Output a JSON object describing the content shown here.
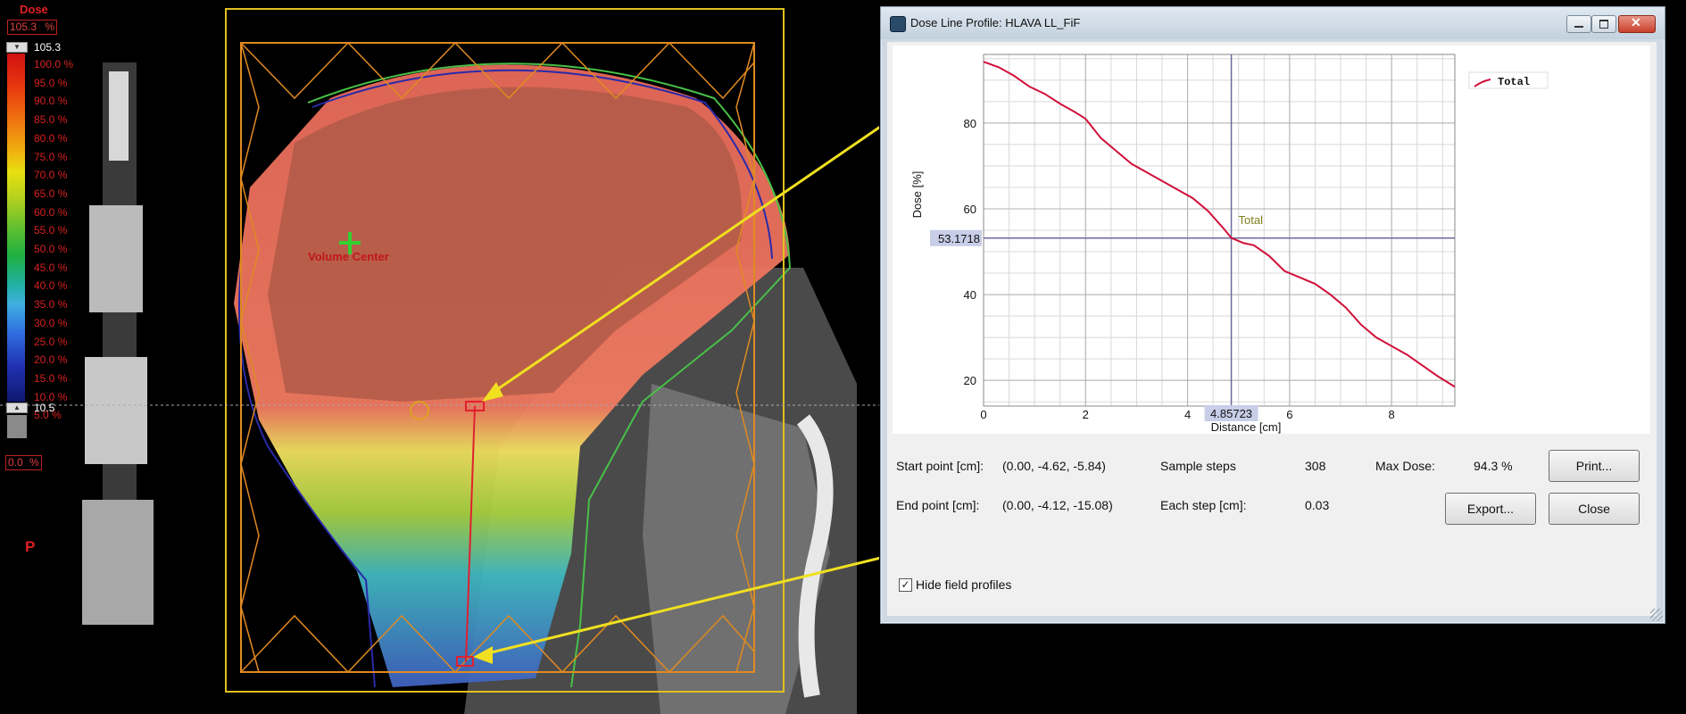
{
  "legend": {
    "title": "Dose",
    "max_box": "105.3",
    "max_box_unit": "%",
    "max_value": "105.3",
    "labels": [
      "100.0 %",
      "95.0 %",
      "90.0 %",
      "85.0 %",
      "80.0 %",
      "75.0 %",
      "70.0 %",
      "65.0 %",
      "60.0 %",
      "55.0 %",
      "50.0 %",
      "45.0 %",
      "40.0 %",
      "35.0 %",
      "30.0 %",
      "25.0 %",
      "20.0 %",
      "15.0 %",
      "10.0 %",
      "5.0 %"
    ],
    "pointer_value": "10.5",
    "min_box": "0.0",
    "min_box_unit": "%",
    "orientation": "P"
  },
  "ct_view": {
    "structure_label": "Volume Center"
  },
  "dialog": {
    "title": "Dose Line Profile: HLAVA LL_FiF",
    "info": {
      "start_label": "Start point [cm]:",
      "start_value": "(0.00, -4.62, -5.84)",
      "end_label": "End point [cm]:",
      "end_value": "(0.00, -4.12, -15.08)",
      "sample_steps_label": "Sample steps",
      "sample_steps_value": "308",
      "each_step_label": "Each step [cm]:",
      "each_step_value": "0.03",
      "max_dose_label": "Max Dose:",
      "max_dose_value": "94.3 %"
    },
    "buttons": {
      "print": "Print...",
      "export": "Export...",
      "close": "Close"
    },
    "checkbox": {
      "label": "Hide field profiles",
      "checked": true,
      "mark": "✓"
    }
  },
  "chart_data": {
    "type": "line",
    "title": "",
    "xlabel": "Distance [cm]",
    "ylabel": "Dose [%]",
    "xlim": [
      0,
      9.24
    ],
    "ylim": [
      14,
      96
    ],
    "xticks": [
      0,
      2,
      4,
      6,
      8
    ],
    "yticks": [
      20,
      40,
      60,
      80
    ],
    "grid": true,
    "legend_position": "top-right",
    "cursor": {
      "x": 4.85723,
      "y": 53.1718,
      "x_label": "4.85723",
      "y_label": "53.1718",
      "tag": "Total"
    },
    "series": [
      {
        "name": "Total",
        "color": "#d0103a",
        "x": [
          0,
          0.3,
          0.6,
          0.9,
          1.2,
          1.5,
          1.8,
          2.0,
          2.3,
          2.6,
          2.9,
          3.2,
          3.5,
          3.8,
          4.1,
          4.4,
          4.7,
          4.86,
          5.1,
          5.3,
          5.6,
          5.9,
          6.2,
          6.5,
          6.8,
          7.1,
          7.4,
          7.7,
          8.0,
          8.3,
          8.6,
          8.9,
          9.24
        ],
        "values": [
          94.3,
          93,
          91,
          88.5,
          86.8,
          84.5,
          82.5,
          81,
          76.5,
          73.5,
          70.5,
          68.5,
          66.5,
          64.5,
          62.5,
          59.5,
          55.5,
          53.2,
          52,
          51.5,
          49,
          45.5,
          44,
          42.5,
          40,
          37,
          33,
          30,
          28,
          26,
          23.5,
          21,
          18.5
        ]
      }
    ]
  }
}
